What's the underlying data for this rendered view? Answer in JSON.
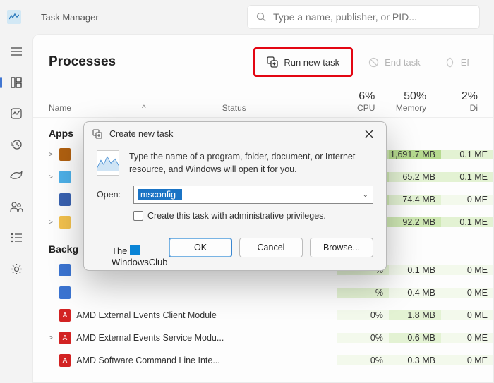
{
  "app": {
    "title": "Task Manager"
  },
  "search": {
    "placeholder": "Type a name, publisher, or PID..."
  },
  "header": {
    "title": "Processes",
    "actions": {
      "run_new_task": "Run new task",
      "end_task": "End task",
      "efficiency": "Ef"
    }
  },
  "columns": {
    "name": "Name",
    "sort_indicator": "^",
    "status": "Status",
    "cpu": {
      "pct": "6%",
      "label": "CPU"
    },
    "memory": {
      "pct": "50%",
      "label": "Memory"
    },
    "disk": {
      "pct": "2%",
      "label": "Di"
    }
  },
  "groups": {
    "apps": "Apps",
    "background": "Backg"
  },
  "rows": [
    {
      "exp": ">",
      "icon_bg": "#b06010",
      "name": "",
      "cpu": "%",
      "mem": "1,691.7 MB",
      "disk": "0.1 ME",
      "h_cpu": "heat3",
      "h_mem": "heat4",
      "h_disk": "heat2"
    },
    {
      "exp": ">",
      "icon_bg": "#4db0e8",
      "name": "",
      "cpu": "%",
      "mem": "65.2 MB",
      "disk": "0.1 ME",
      "h_cpu": "heat3",
      "h_mem": "heat2",
      "h_disk": "heat2"
    },
    {
      "exp": "",
      "icon_bg": "#3a62b0",
      "name": "",
      "cpu": "%",
      "mem": "74.4 MB",
      "disk": "0 ME",
      "h_cpu": "heat3",
      "h_mem": "heat2",
      "h_disk": "heat1"
    },
    {
      "exp": ">",
      "icon_bg": "#f2c14e",
      "name": "",
      "cpu": "%",
      "mem": "92.2 MB",
      "disk": "0.1 ME",
      "h_cpu": "heat3",
      "h_mem": "heat3",
      "h_disk": "heat2"
    }
  ],
  "bg_rows": [
    {
      "exp": "",
      "icon_bg": "#3b74d1",
      "icon_txt": "",
      "name": "",
      "cpu": "%",
      "mem": "0.1 MB",
      "disk": "0 ME",
      "h_cpu": "heat2",
      "h_mem": "heat1",
      "h_disk": "heat1"
    },
    {
      "exp": "",
      "icon_bg": "#3b74d1",
      "icon_txt": "",
      "name": "",
      "cpu": "%",
      "mem": "0.4 MB",
      "disk": "0 ME",
      "h_cpu": "heat2",
      "h_mem": "heat1",
      "h_disk": "heat1"
    },
    {
      "exp": "",
      "icon_bg": "#d22222",
      "icon_txt": "A",
      "name": "AMD External Events Client Module",
      "cpu": "0%",
      "mem": "1.8 MB",
      "disk": "0 ME",
      "h_cpu": "heat1",
      "h_mem": "heat2",
      "h_disk": "heat1"
    },
    {
      "exp": ">",
      "icon_bg": "#d22222",
      "icon_txt": "A",
      "name": "AMD External Events Service Modu...",
      "cpu": "0%",
      "mem": "0.6 MB",
      "disk": "0 ME",
      "h_cpu": "heat1",
      "h_mem": "heat2",
      "h_disk": "heat1"
    },
    {
      "exp": "",
      "icon_bg": "#d22222",
      "icon_txt": "A",
      "name": "AMD Software Command Line Inte...",
      "cpu": "0%",
      "mem": "0.3 MB",
      "disk": "0 ME",
      "h_cpu": "heat1",
      "h_mem": "heat1",
      "h_disk": "heat1"
    }
  ],
  "dialog": {
    "title": "Create new task",
    "description": "Type the name of a program, folder, document, or Internet resource, and Windows will open it for you.",
    "open_label": "Open:",
    "open_value": "msconfig",
    "checkbox_label": "Create this task with administrative privileges.",
    "buttons": {
      "ok": "OK",
      "cancel": "Cancel",
      "browse": "Browse..."
    }
  },
  "watermark": {
    "line1": "The",
    "line2": "WindowsClub"
  }
}
